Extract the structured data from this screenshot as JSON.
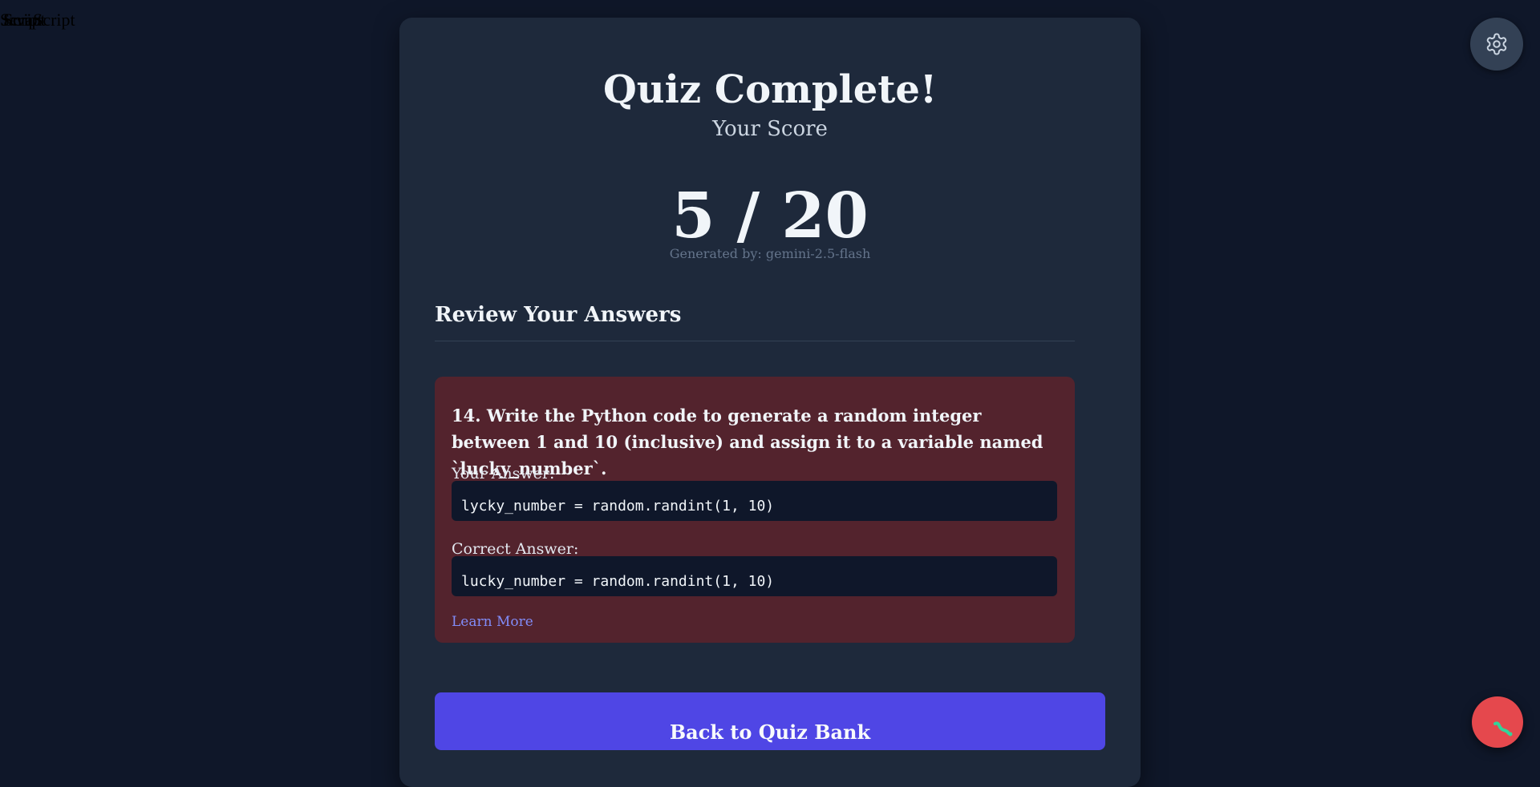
{
  "corner_text": [
    "Script",
    "JavaScript",
    "Script"
  ],
  "quiz": {
    "title": "Quiz Complete!",
    "subtitle": "Your Score",
    "score": "5 / 20",
    "generated_by": "Generated by: gemini-2.5-flash"
  },
  "review": {
    "heading": "Review Your Answers",
    "items": [
      {
        "question": "14. Write the Python code to generate a random integer between 1 and 10 (inclusive) and assign it to a variable named `lucky_number`.",
        "your_answer_label": "Your Answer:",
        "your_answer": "lycky_number = random.randint(1, 10)",
        "correct_answer_label": "Correct Answer:",
        "correct_answer": "lucky_number = random.randint(1, 10)",
        "learn_more": "Learn More",
        "status_color": "#53232d"
      }
    ]
  },
  "actions": {
    "back_label": "Back to Quiz Bank"
  },
  "icons": {
    "settings": "gear-icon",
    "debug": "bug-icon"
  },
  "colors": {
    "background": "#0f1729",
    "card": "#1e293b",
    "incorrect": "#53232d",
    "accent": "#4f46e5",
    "link": "#818cf8",
    "debug_button": "#e5484d"
  }
}
